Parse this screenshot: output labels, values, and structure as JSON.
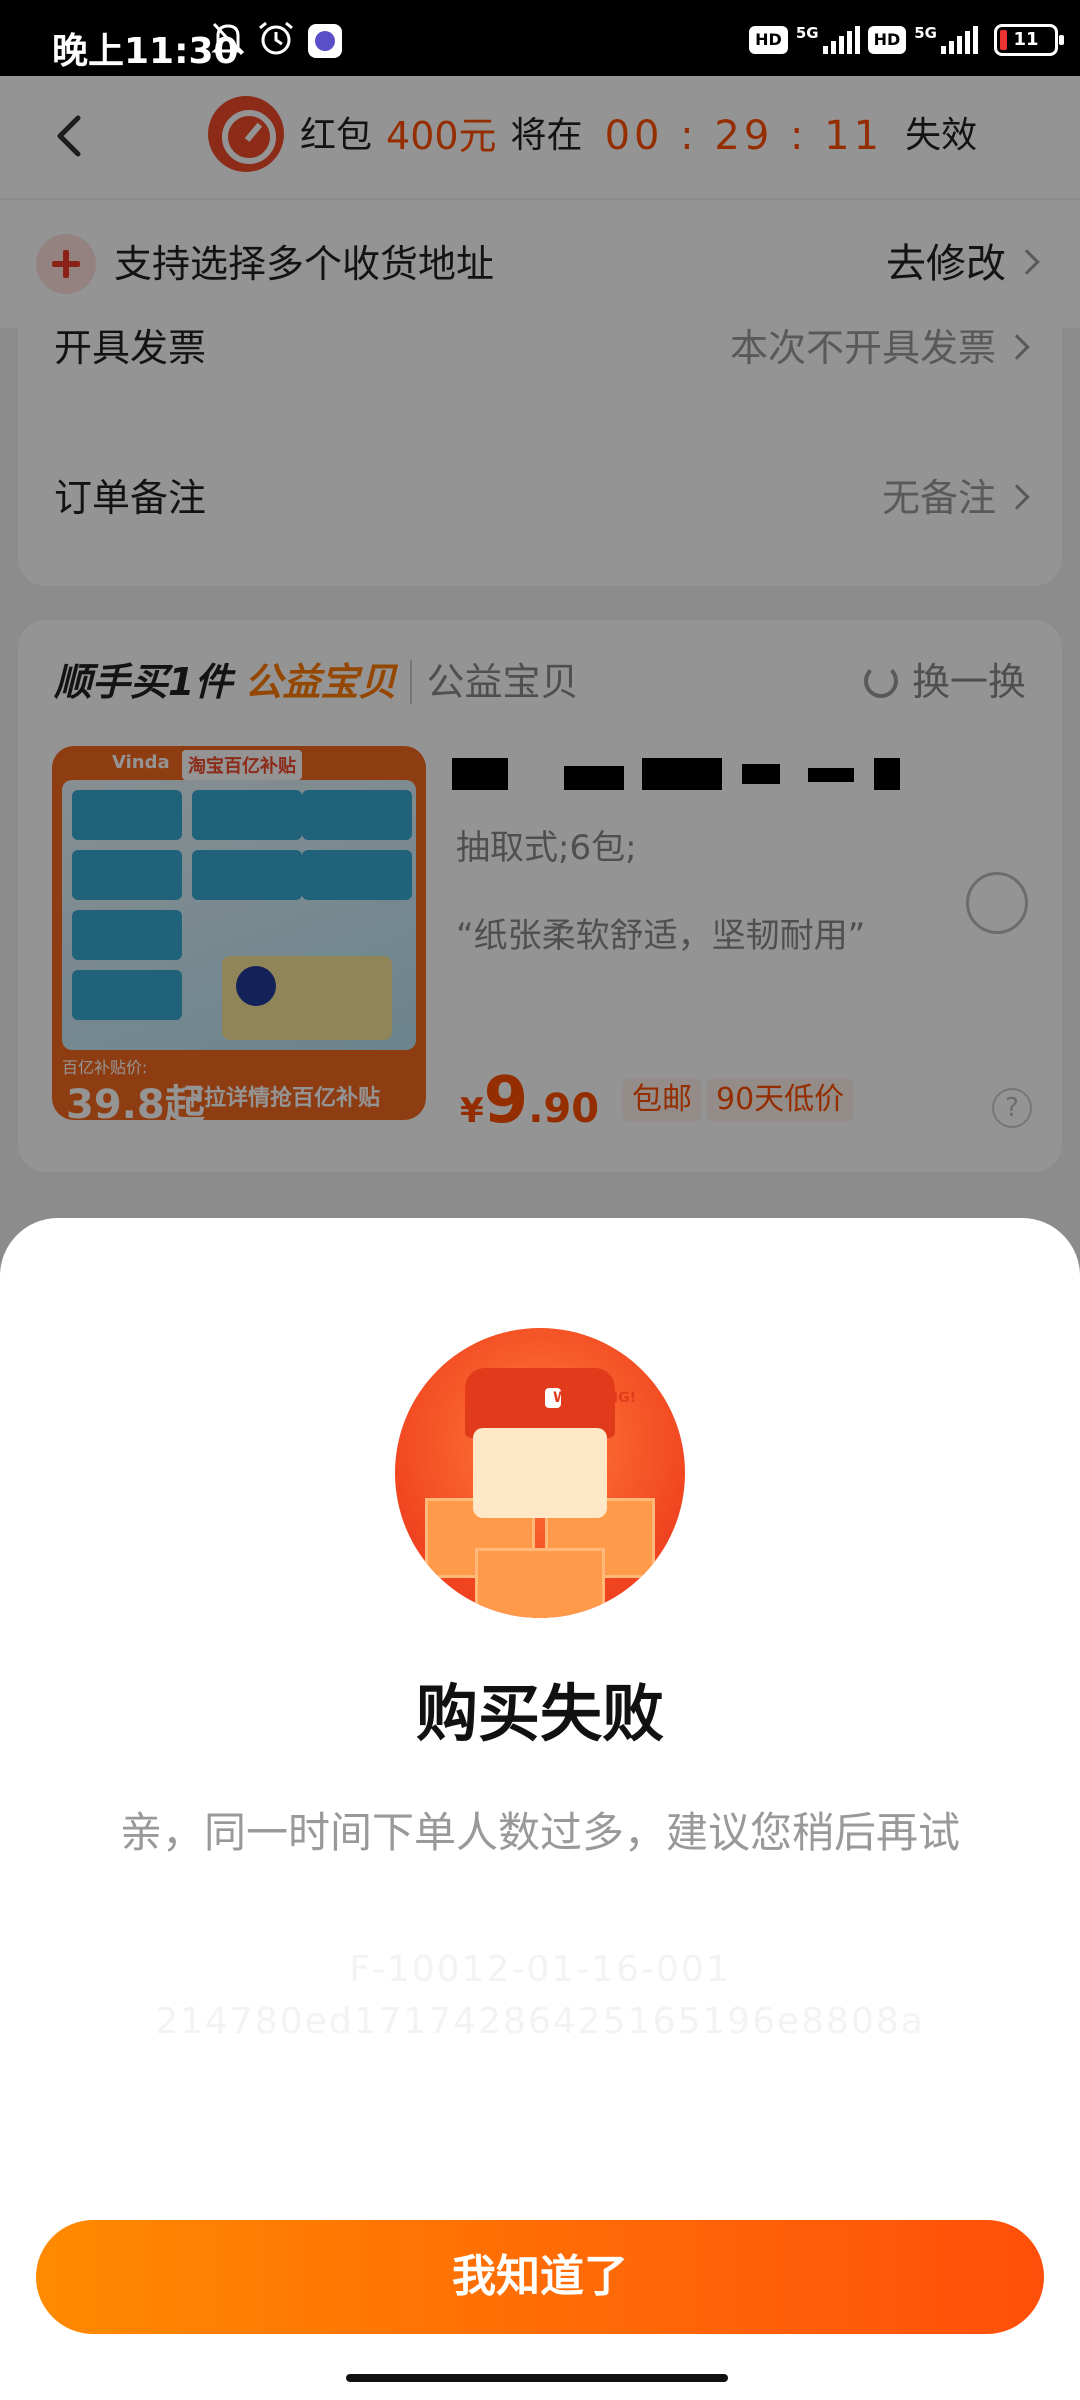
{
  "status_bar": {
    "time": "晚上11:30",
    "hd1": "HD",
    "net1": "5G",
    "hd2": "HD",
    "net2": "5G",
    "battery": "11",
    "battery_color": "#e33333"
  },
  "header": {
    "label": "红包",
    "amount": "400元",
    "mid": "将在",
    "countdown": "00 : 29 : 11",
    "suffix": "失效"
  },
  "address": {
    "text": "支持选择多个收货地址",
    "action": "去修改"
  },
  "invoice": {
    "label": "开具发票",
    "value": "本次不开具发票"
  },
  "remark": {
    "label": "订单备注",
    "value": "无备注"
  },
  "recommend": {
    "title": "顺手买1件",
    "highlight": "公益宝贝",
    "sub": "公益宝贝",
    "swap": "换一换"
  },
  "product": {
    "image_tag_left": "Vinda",
    "image_tag_right": "淘宝百亿补贴",
    "image_price_label": "百亿补贴价:",
    "image_price": "39.8起",
    "image_bottom": "下拉详情抢百亿补贴",
    "spec": "抽取式;6包;",
    "quote": "“纸张柔软舒适，坚韧耐用”",
    "price_currency": "¥",
    "price_int": "9",
    "price_dec": ".90",
    "badge_shipping": "包邮",
    "badge_low": "90天低价",
    "help": "?"
  },
  "dialog": {
    "illustration_text": "WARNING!",
    "title": "购买失败",
    "message": "亲，同一时间下单人数过多，建议您稍后再试",
    "code_line1": "F-10012-01-16-001",
    "code_line2": "214780ed17174286425165196e8808a",
    "button": "我知道了",
    "accent_color": "#ff5000"
  }
}
